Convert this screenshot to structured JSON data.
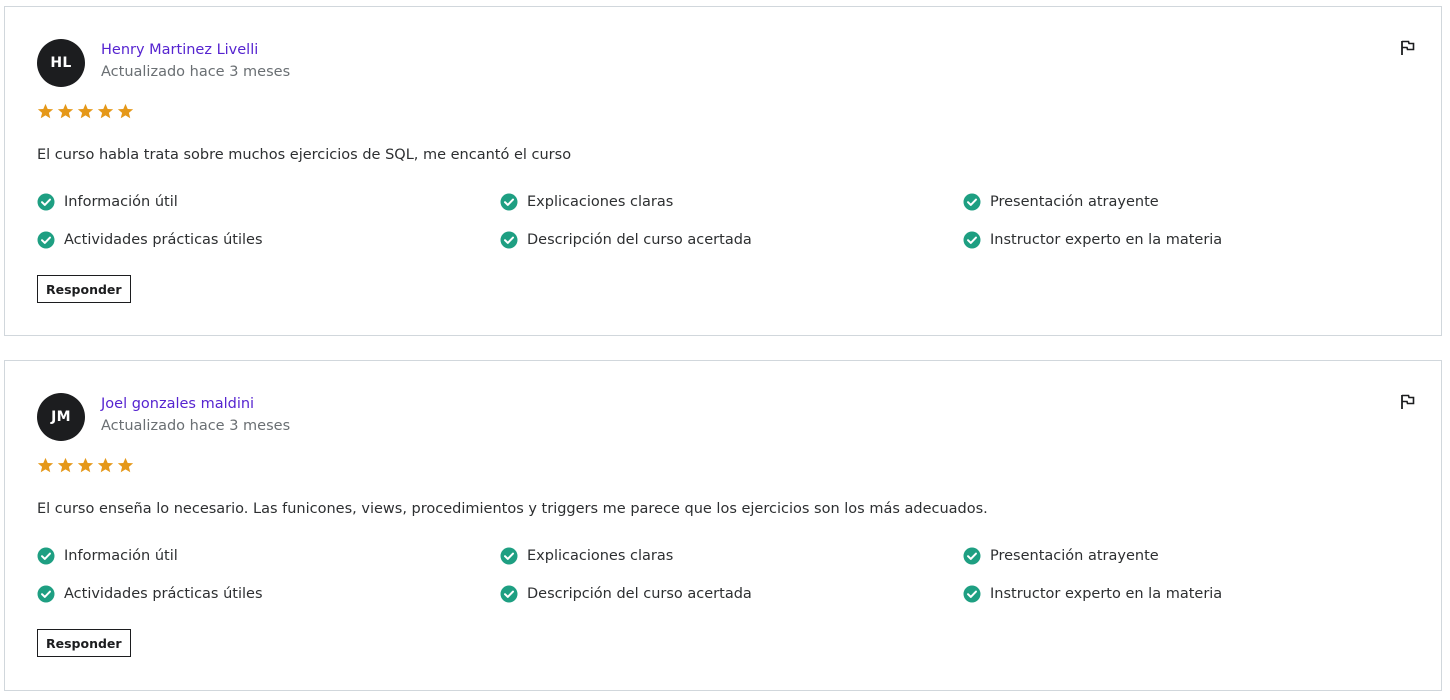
{
  "colors": {
    "name_link": "#5624d0",
    "star": "#e59819",
    "check": "#1e9f82",
    "avatar_bg": "#1c1d1f"
  },
  "icons": {
    "flag": "flag-icon",
    "star": "star-icon",
    "check": "check-circle-icon"
  },
  "reviews": [
    {
      "initials": "HL",
      "name": "Henry Martinez Livelli",
      "updated": "Actualizado hace 3 meses",
      "rating": 5,
      "comment": "El curso habla trata sobre muchos ejercicios de SQL, me encantó el curso",
      "attributes": [
        "Información útil",
        "Explicaciones claras",
        "Presentación atrayente",
        "Actividades prácticas útiles",
        "Descripción del curso acertada",
        "Instructor experto en la materia"
      ],
      "reply_label": "Responder"
    },
    {
      "initials": "JM",
      "name": "Joel gonzales maldini",
      "updated": "Actualizado hace 3 meses",
      "rating": 5,
      "comment": "El curso enseña lo necesario. Las funicones, views, procedimientos y triggers me parece que los ejercicios son los más adecuados.",
      "attributes": [
        "Información útil",
        "Explicaciones claras",
        "Presentación atrayente",
        "Actividades prácticas útiles",
        "Descripción del curso acertada",
        "Instructor experto en la materia"
      ],
      "reply_label": "Responder"
    }
  ]
}
